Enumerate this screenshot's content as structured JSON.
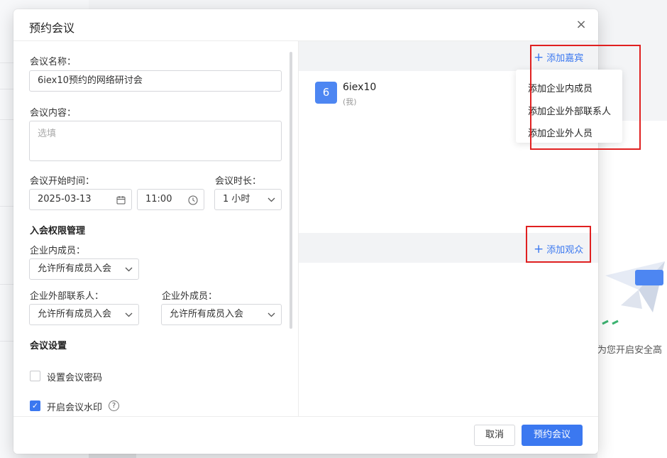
{
  "dialog": {
    "title": "预约会议",
    "close_glyph": "×"
  },
  "form": {
    "meeting_name_label": "会议名称：",
    "meeting_name_value": "6iex10预约的网络研讨会",
    "meeting_content_label": "会议内容：",
    "meeting_content_placeholder": "选填",
    "start_time_label": "会议开始时间：",
    "start_date": "2025-03-13",
    "start_time": "11:00",
    "duration_label": "会议时长：",
    "duration_value": "1 小时",
    "permission_section": "入会权限管理",
    "internal_members_label": "企业内成员：",
    "internal_members_value": "允许所有成员入会",
    "external_contacts_label": "企业外部联系人：",
    "external_contacts_value": "允许所有成员入会",
    "external_members_label": "企业外成员：",
    "external_members_value": "允许所有成员入会",
    "settings_section": "会议设置",
    "password_label": "设置会议密码",
    "password_checked": false,
    "watermark_label": "开启会议水印",
    "watermark_checked": true
  },
  "guests": {
    "add_guest_label": "添加嘉宾",
    "add_audience_label": "添加观众",
    "plus_glyph": "+",
    "list": [
      {
        "avatar_text": "6",
        "name": "6iex10",
        "note": "(我)"
      }
    ],
    "dropdown": [
      "添加企业内成员",
      "添加企业外部联系人",
      "添加企业外人员"
    ]
  },
  "footer": {
    "cancel_label": "取消",
    "submit_label": "预约会议"
  },
  "background": {
    "safety_text": "为您开启安全高"
  },
  "colors": {
    "accent": "#3b78f0",
    "highlight_box": "#e02020"
  }
}
